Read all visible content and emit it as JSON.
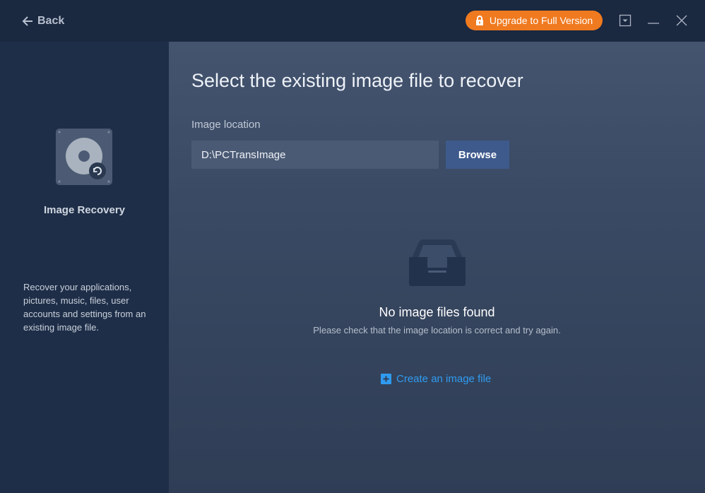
{
  "titlebar": {
    "back_label": "Back",
    "upgrade_label": "Upgrade to Full Version",
    "upgrade_color": "#f07a1f"
  },
  "sidebar": {
    "title": "Image Recovery",
    "icon": "disk-recovery-icon",
    "description": "Recover your applications, pictures, music, files, user accounts and settings from an existing image file."
  },
  "main": {
    "heading": "Select the existing image file to recover",
    "location_label": "Image location",
    "location_value": "D:\\PCTransImage",
    "browse_label": "Browse",
    "empty_title": "No image files found",
    "empty_subtitle": "Please check that the image location is correct and try again.",
    "create_link": "Create an image file",
    "link_color": "#2f9bf0"
  }
}
